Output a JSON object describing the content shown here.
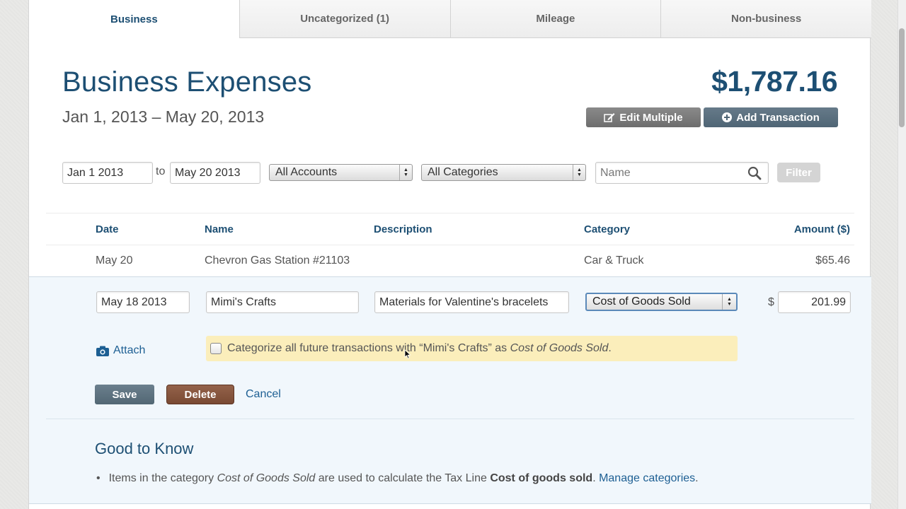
{
  "tabs": [
    {
      "label": "Business"
    },
    {
      "label": "Uncategorized (1)"
    },
    {
      "label": "Mileage"
    },
    {
      "label": "Non-business"
    }
  ],
  "header": {
    "title": "Business Expenses",
    "date_range": "Jan 1, 2013 – May 20, 2013",
    "total": "$1,787.16",
    "edit_multiple_label": "Edit Multiple",
    "add_transaction_label": "Add Transaction"
  },
  "filters": {
    "start_date": "Jan 1 2013",
    "to_label": "to",
    "end_date": "May 20 2013",
    "accounts_selected": "All Accounts",
    "categories_selected": "All Categories",
    "name_placeholder": "Name",
    "filter_label": "Filter"
  },
  "table": {
    "headers": {
      "date": "Date",
      "name": "Name",
      "description": "Description",
      "category": "Category",
      "amount": "Amount ($)"
    },
    "rows": [
      {
        "date": "May 20",
        "name": "Chevron Gas Station #21103",
        "description": "",
        "category": "Car & Truck",
        "amount": "$65.46"
      }
    ]
  },
  "edit_form": {
    "date": "May 18 2013",
    "name": "Mimi's Crafts",
    "description": "Materials for Valentine's bracelets",
    "category": "Cost of Goods Sold",
    "currency_symbol": "$",
    "amount": "201.99",
    "attach_label": "Attach",
    "suggestion_prefix": "Categorize all future transactions with “Mimi's Crafts” as ",
    "suggestion_category": "Cost of Goods Sold",
    "suggestion_suffix": ".",
    "save_label": "Save",
    "delete_label": "Delete",
    "cancel_label": "Cancel"
  },
  "good_to_know": {
    "title": "Good to Know",
    "item_prefix": "Items in the category ",
    "item_category": "Cost of Goods Sold",
    "item_middle": " are used to calculate the Tax Line ",
    "item_taxline": "Cost of goods sold",
    "item_after": ". ",
    "manage_link": "Manage categories",
    "item_end": "."
  },
  "colors": {
    "brand_blue": "#1d4f73",
    "link_blue": "#1d5f93",
    "panel_bg": "#f1f7fc",
    "suggest_bg": "#fbeebb",
    "delete_brown": "#7a4a33"
  },
  "icons": [
    "edit-icon",
    "plus-circle-icon",
    "search-icon",
    "camera-icon",
    "select-arrows-icon",
    "bullet-icon"
  ]
}
